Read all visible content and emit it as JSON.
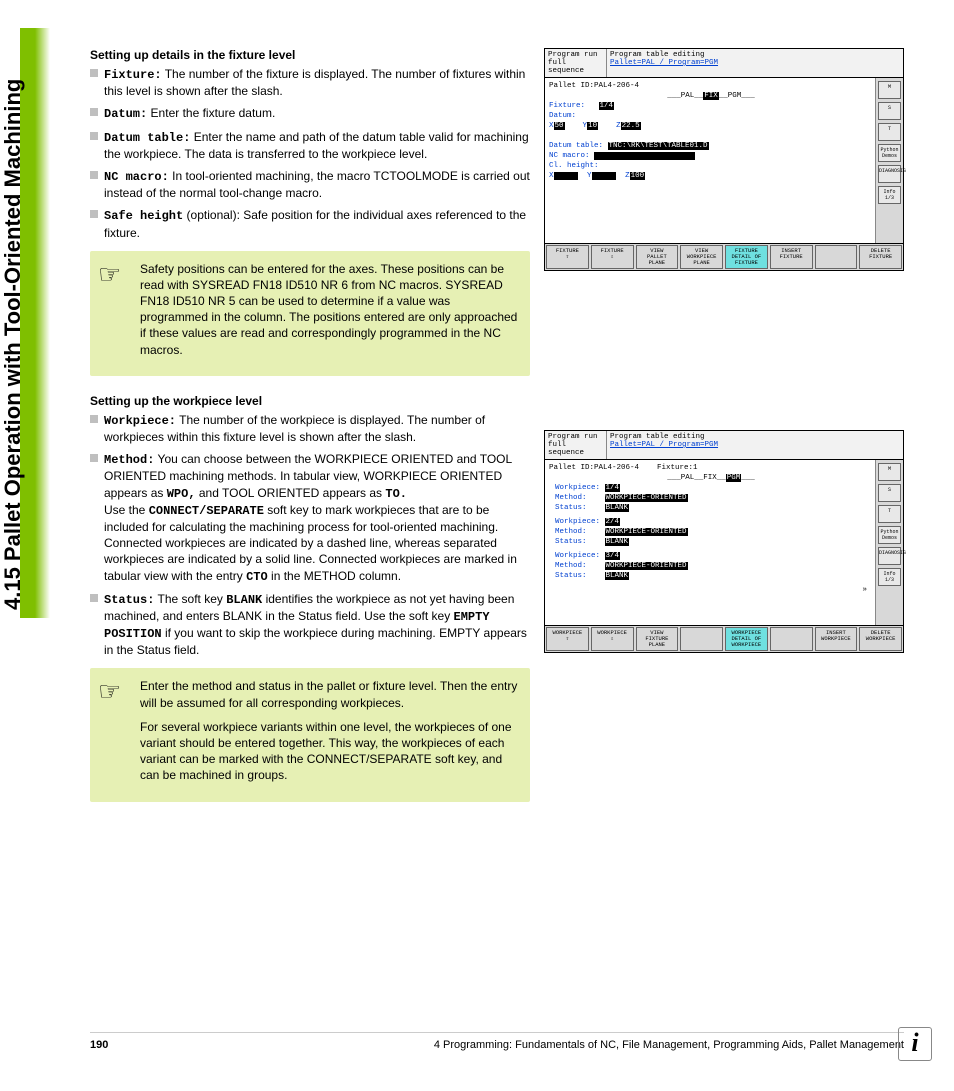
{
  "sideTitle": "4.15 Pallet Operation with Tool-Oriented Machining",
  "section1": {
    "heading": "Setting up details in the fixture level",
    "b1_label": "Fixture:",
    "b1_text": " The number of the fixture is displayed. The number of fixtures within this level is shown after the slash.",
    "b2_label": "Datum:",
    "b2_text": " Enter the fixture datum.",
    "b3_label": "Datum table:",
    "b3_text": " Enter the name and path of the datum table valid for machining the workpiece. The data is transferred to the workpiece level.",
    "b4_label": "NC macro:",
    "b4_text": " In tool-oriented machining, the macro TCTOOLMODE is carried out instead of the normal tool-change macro.",
    "b5_label": "Safe height",
    "b5_text": " (optional): Safe position for the individual axes referenced to the fixture.",
    "note": "Safety positions can be entered for the axes. These positions can be read with SYSREAD FN18 ID510 NR 6 from NC macros. SYSREAD FN18 ID510 NR 5 can be used to determine if a value was programmed in the column. The positions entered are only approached if these values are read and correspondingly programmed in the NC macros."
  },
  "section2": {
    "heading": "Setting up the workpiece level",
    "b1_label": "Workpiece:",
    "b1_text": " The number of the workpiece is displayed. The number of workpieces within this fixture level is shown after the slash.",
    "b2_label": "Method:",
    "b2_pre": " You can choose between the WORKPIECE ORIENTED and TOOL ORIENTED machining methods. In tabular view, WORKPIECE ORIENTED appears as ",
    "b2_mono1": "WPO,",
    "b2_mid": " and TOOL ORIENTED appears as ",
    "b2_mono2": "TO.",
    "b2_break": "Use the ",
    "b2_mono3": "CONNECT/SEPARATE",
    "b2_post": " soft key to mark workpieces that are to be included for calculating the machining process for tool-oriented machining. Connected workpieces are indicated by a dashed line, whereas separated workpieces are indicated by a solid line. Connected workpieces are marked in tabular view with the entry ",
    "b2_mono4": "CTO",
    "b2_end": " in the METHOD column.",
    "b3_label": "Status:",
    "b3_pre": " The soft key ",
    "b3_mono1": "BLANK",
    "b3_mid": " identifies the workpiece as not yet having been machined, and enters BLANK in the Status field. Use the soft key ",
    "b3_mono2": "EMPTY POSITION",
    "b3_end": " if you want to skip the workpiece during machining. EMPTY appears in the Status field.",
    "note1": "Enter the method and status in the pallet or fixture level. Then the entry will be assumed for all corresponding workpieces.",
    "note2": "For several workpiece variants within one level, the workpieces of one variant should be entered together. This way, the workpieces of each variant can be marked with the CONNECT/SEPARATE soft key, and can be machined in groups."
  },
  "shot1": {
    "mode": "Program run\nfull sequence",
    "title": "Program table editing",
    "sub": "Pallet=PAL / Program=PGM",
    "palletId": "Pallet ID:PAL4-206-4",
    "tabs": "PAL  FIX  PGM",
    "fixture_lbl": "Fixture:",
    "fixture_val": "1/4",
    "datum_lbl": "Datum:",
    "x_lbl": "X",
    "x_val": "50",
    "y_lbl": "Y",
    "y_val": "10",
    "z_lbl": "Z",
    "z_val": "22.5",
    "dt_lbl": "Datum table:",
    "dt_val": "TNC:\\RK\\TEST\\TABLE01.D",
    "nc_lbl": "NC macro:",
    "cl_lbl": "Cl. height:",
    "x2_lbl": "X",
    "y2_lbl": "Y",
    "z2_lbl": "Z",
    "z2_val": "100",
    "side": [
      "M",
      "S",
      "T",
      "Python\nDemos",
      "DIAGNOSIS",
      "Info 1/3"
    ],
    "sk": [
      "FIXTURE\n⇧",
      "FIXTURE\n⇩",
      "VIEW\nPALLET\nPLANE",
      "VIEW\nWORKPIECE\nPLANE",
      "FIXTURE\nDETAIL OF\nFIXTURE",
      "INSERT\nFIXTURE",
      "",
      "DELETE\nFIXTURE"
    ]
  },
  "shot2": {
    "mode": "Program run\nfull sequence",
    "title": "Program table editing",
    "sub": "Pallet=PAL / Program=PGM",
    "palletId": "Pallet ID:PAL4-206-4",
    "fixture": "Fixture:1",
    "tabs": "PAL  FIX  PGM",
    "wp": [
      {
        "n": "1/4",
        "method": "WORKPIECE-ORIENTED",
        "status": "BLANK"
      },
      {
        "n": "2/4",
        "method": "WORKPIECE-ORIENTED",
        "status": "BLANK"
      },
      {
        "n": "3/4",
        "method": "WORKPIECE-ORIENTED",
        "status": "BLANK"
      }
    ],
    "wp_lbl": "Workpiece:",
    "m_lbl": "Method:",
    "s_lbl": "Status:",
    "side": [
      "M",
      "S",
      "T",
      "Python\nDemos",
      "DIAGNOSIS",
      "Info 1/3"
    ],
    "sk": [
      "WORKPIECE\n⇧",
      "WORKPIECE\n⇩",
      "VIEW\nFIXTURE\nPLANE",
      "",
      "WORKPIECE\nDETAIL OF\nWORKPIECE",
      "",
      "INSERT\nWORKPIECE",
      "DELETE\nWORKPIECE"
    ]
  },
  "footer": {
    "page": "190",
    "chapter": "4 Programming: Fundamentals of NC, File Management, Programming Aids, Pallet Management"
  }
}
